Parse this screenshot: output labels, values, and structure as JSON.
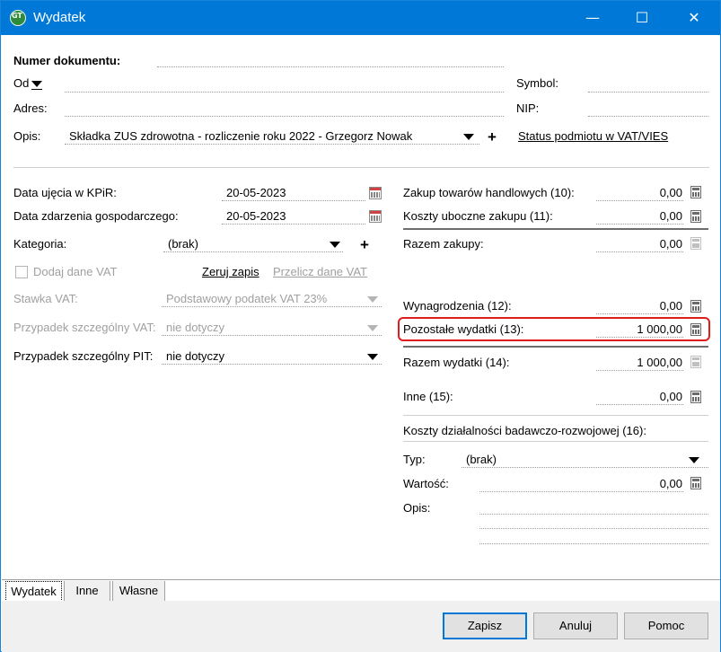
{
  "window": {
    "title": "Wydatek",
    "icon": "app-logo-icon",
    "controls": {
      "minimize": "—",
      "maximize": "☐",
      "close": "✕"
    }
  },
  "header": {
    "numer_label": "Numer dokumentu:",
    "od_label": "Od",
    "adres_label": "Adres:",
    "opis_label": "Opis:",
    "opis_value": "Składka ZUS zdrowotna - rozliczenie roku 2022 - Grzegorz Nowak",
    "symbol_label": "Symbol:",
    "nip_label": "NIP:",
    "status_link": "Status podmiotu w VAT/VIES",
    "plus": "+"
  },
  "left": {
    "data_ujecia_label": "Data ujęcia w KPiR:",
    "data_ujecia_value": "20-05-2023",
    "data_zdarzenia_label": "Data zdarzenia gospodarczego:",
    "data_zdarzenia_value": "20-05-2023",
    "kategoria_label": "Kategoria:",
    "kategoria_value": "(brak)",
    "dodaj_vat_label": "Dodaj dane VAT",
    "zeruj_link": "Zeruj zapis",
    "przelicz_link": "Przelicz dane VAT",
    "stawka_label": "Stawka VAT:",
    "stawka_value": "Podstawowy podatek VAT 23%",
    "przypadek_vat_label": "Przypadek szczególny VAT:",
    "przypadek_vat_value": "nie dotyczy",
    "przypadek_pit_label": "Przypadek szczególny PIT:",
    "przypadek_pit_value": "nie dotyczy",
    "plus": "+"
  },
  "right": {
    "zakup_label": "Zakup towarów handlowych (10):",
    "zakup_value": "0,00",
    "koszty_uboczne_label": "Koszty uboczne zakupu (11):",
    "koszty_uboczne_value": "0,00",
    "razem_zakupy_label": "Razem zakupy:",
    "razem_zakupy_value": "0,00",
    "wynagrodzenia_label": "Wynagrodzenia (12):",
    "wynagrodzenia_value": "0,00",
    "pozostale_label": "Pozostałe wydatki (13):",
    "pozostale_value": "1 000,00",
    "razem_wydatki_label": "Razem wydatki (14):",
    "razem_wydatki_value": "1 000,00",
    "inne_label": "Inne (15):",
    "inne_value": "0,00",
    "koszty_br_label": "Koszty działalności badawczo-rozwojowej (16):",
    "typ_label": "Typ:",
    "typ_value": "(brak)",
    "wartosc_label": "Wartość:",
    "wartosc_value": "0,00",
    "opis_label": "Opis:"
  },
  "tabs": [
    "Wydatek",
    "Inne",
    "Własne"
  ],
  "buttons": {
    "zapisz": "Zapisz",
    "anuluj": "Anuluj",
    "pomoc": "Pomoc"
  },
  "colors": {
    "titlebar": "#0078d7",
    "highlight": "#e01c1c",
    "default_button_border": "#0078d7"
  }
}
